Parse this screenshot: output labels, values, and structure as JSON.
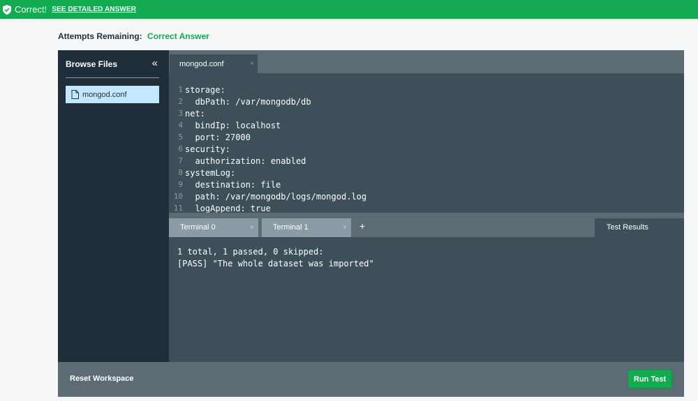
{
  "banner": {
    "status": "Correct!",
    "detail_link": "SEE DETAILED ANSWER",
    "icon": "shield-check-icon",
    "color": "#13aa52"
  },
  "attempts": {
    "label": "Attempts Remaining:",
    "value": "Correct Answer"
  },
  "sidebar": {
    "title": "Browse Files",
    "collapse_symbol": "«",
    "files": [
      {
        "name": "mongod.conf",
        "icon": "file-icon",
        "selected": true
      }
    ]
  },
  "editor": {
    "tab_label": "mongod.conf",
    "close_symbol": "×",
    "lines": [
      {
        "num": "1",
        "text": "storage:"
      },
      {
        "num": "2",
        "text": "  dbPath: /var/mongodb/db"
      },
      {
        "num": "3",
        "text": "net:"
      },
      {
        "num": "4",
        "text": "  bindIp: localhost"
      },
      {
        "num": "5",
        "text": "  port: 27000"
      },
      {
        "num": "6",
        "text": "security:"
      },
      {
        "num": "7",
        "text": "  authorization: enabled"
      },
      {
        "num": "8",
        "text": "systemLog:"
      },
      {
        "num": "9",
        "text": "  destination: file"
      },
      {
        "num": "10",
        "text": "  path: /var/mongodb/logs/mongod.log"
      },
      {
        "num": "11",
        "text": "  logAppend: true"
      }
    ]
  },
  "terminal": {
    "tabs": [
      {
        "label": "Terminal 0",
        "close": "×"
      },
      {
        "label": "Terminal 1",
        "close": "×"
      }
    ],
    "add_symbol": "+",
    "results_tab": "Test Results",
    "output": [
      "1 total, 1 passed, 0 skipped:",
      "[PASS] \"The whole dataset was imported\""
    ]
  },
  "footer": {
    "reset_label": "Reset Workspace",
    "run_label": "Run Test"
  }
}
